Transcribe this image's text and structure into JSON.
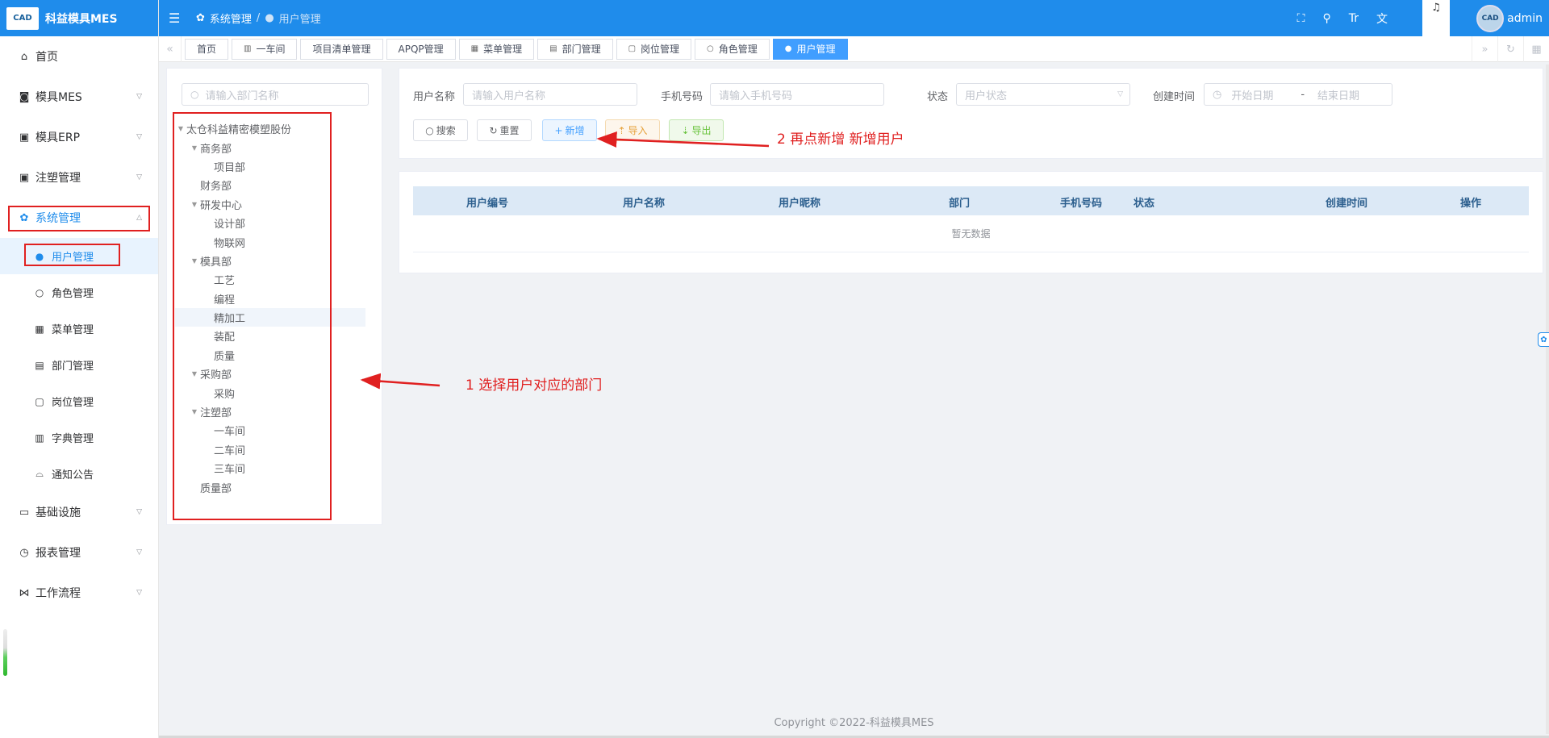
{
  "app": {
    "logo_text": "CAD",
    "title": "科益模具MES"
  },
  "sidebar": {
    "items": [
      {
        "label": "首页",
        "icon": "home-icon"
      },
      {
        "label": "模具MES",
        "icon": "camera-icon"
      },
      {
        "label": "模具ERP",
        "icon": "bag-icon"
      },
      {
        "label": "注塑管理",
        "icon": "bag-icon"
      },
      {
        "label": "系统管理",
        "icon": "gear-icon"
      }
    ],
    "sub_items": [
      {
        "label": "用户管理",
        "icon": "user-icon"
      },
      {
        "label": "角色管理",
        "icon": "person-icon"
      },
      {
        "label": "菜单管理",
        "icon": "grid-icon"
      },
      {
        "label": "部门管理",
        "icon": "card-icon"
      },
      {
        "label": "岗位管理",
        "icon": "badge-icon"
      },
      {
        "label": "字典管理",
        "icon": "book-icon"
      },
      {
        "label": "通知公告",
        "icon": "bell-icon"
      }
    ],
    "bottom_items": [
      {
        "label": "基础设施",
        "icon": "monitor-icon"
      },
      {
        "label": "报表管理",
        "icon": "clock-icon"
      },
      {
        "label": "工作流程",
        "icon": "flow-icon"
      }
    ]
  },
  "header": {
    "breadcrumb_parent": "系统管理",
    "breadcrumb_sep": "/",
    "breadcrumb_current": "用户管理",
    "username": "admin",
    "avatar_text": "CAD"
  },
  "tabs": [
    "首页",
    "一车间",
    "项目清单管理",
    "APQP管理",
    "菜单管理",
    "部门管理",
    "岗位管理",
    "角色管理",
    "用户管理"
  ],
  "dept": {
    "search_placeholder": "请输入部门名称",
    "tree": [
      {
        "label": "太仓科益精密模塑股份",
        "level": 0,
        "expanded": true
      },
      {
        "label": "商务部",
        "level": 1,
        "expanded": true
      },
      {
        "label": "项目部",
        "level": 2
      },
      {
        "label": "财务部",
        "level": 1
      },
      {
        "label": "研发中心",
        "level": 1,
        "expanded": true
      },
      {
        "label": "设计部",
        "level": 2
      },
      {
        "label": "物联网",
        "level": 2
      },
      {
        "label": "模具部",
        "level": 1,
        "expanded": true
      },
      {
        "label": "工艺",
        "level": 2
      },
      {
        "label": "编程",
        "level": 2
      },
      {
        "label": "精加工",
        "level": 2,
        "selected": true
      },
      {
        "label": "装配",
        "level": 2
      },
      {
        "label": "质量",
        "level": 2
      },
      {
        "label": "采购部",
        "level": 1,
        "expanded": true
      },
      {
        "label": "采购",
        "level": 2
      },
      {
        "label": "注塑部",
        "level": 1,
        "expanded": true
      },
      {
        "label": "一车间",
        "level": 2
      },
      {
        "label": "二车间",
        "level": 2
      },
      {
        "label": "三车间",
        "level": 2
      },
      {
        "label": "质量部",
        "level": 1
      }
    ]
  },
  "filters": {
    "username_label": "用户名称",
    "username_placeholder": "请输入用户名称",
    "phone_label": "手机号码",
    "phone_placeholder": "请输入手机号码",
    "status_label": "状态",
    "status_placeholder": "用户状态",
    "created_label": "创建时间",
    "start_placeholder": "开始日期",
    "range_sep": "-",
    "end_placeholder": "结束日期"
  },
  "buttons": {
    "search": "搜索",
    "reset": "重置",
    "add": "新增",
    "import": "导入",
    "export": "导出"
  },
  "table": {
    "columns": [
      "用户编号",
      "用户名称",
      "用户昵称",
      "部门",
      "手机号码",
      "状态",
      "创建时间",
      "操作"
    ],
    "empty_text": "暂无数据"
  },
  "annotations": {
    "step1": "1 选择用户对应的部门",
    "step2": "2 再点新增 新增用户"
  },
  "footer": "Copyright ©2022-科益模具MES",
  "colors": {
    "primary": "#1f8ceb",
    "annotation": "#e02020"
  }
}
